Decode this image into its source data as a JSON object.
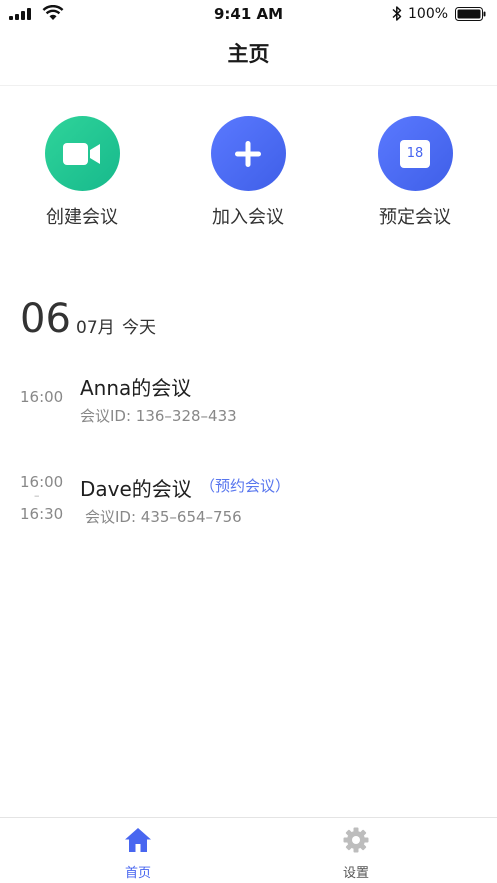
{
  "status_bar": {
    "time": "9:41 AM",
    "battery_percent": "100%",
    "signal_icon": "cellular-signal-icon",
    "wifi_icon": "wifi-icon",
    "bluetooth_icon": "bluetooth-icon",
    "battery_icon": "battery-icon"
  },
  "nav": {
    "title": "主页"
  },
  "actions": [
    {
      "label": "创建会议",
      "icon": "video-camera-icon",
      "color": "#1fc491"
    },
    {
      "label": "加入会议",
      "icon": "plus-icon",
      "color": "#4a6cf7"
    },
    {
      "label": "预定会议",
      "icon": "calendar-icon",
      "color": "#4a6cf7",
      "icon_text": "18"
    }
  ],
  "date_header": {
    "day": "06",
    "month": "07月",
    "today": "今天"
  },
  "meetings": [
    {
      "start_time": "16:00",
      "title": "Anna的会议",
      "meeting_id": "会议ID: 136–328–433"
    },
    {
      "start_time": "16:00",
      "end_time": "16:30",
      "separator": "–",
      "title": "Dave的会议",
      "tag": "（预约会议）",
      "meeting_id": "会议ID: 435–654–756"
    }
  ],
  "tab_bar": {
    "tabs": [
      {
        "label": "首页",
        "icon": "home-icon",
        "active": true
      },
      {
        "label": "设置",
        "icon": "gear-icon",
        "active": false
      }
    ],
    "active_color": "#4866f0",
    "inactive_color": "#bdbdbd"
  }
}
